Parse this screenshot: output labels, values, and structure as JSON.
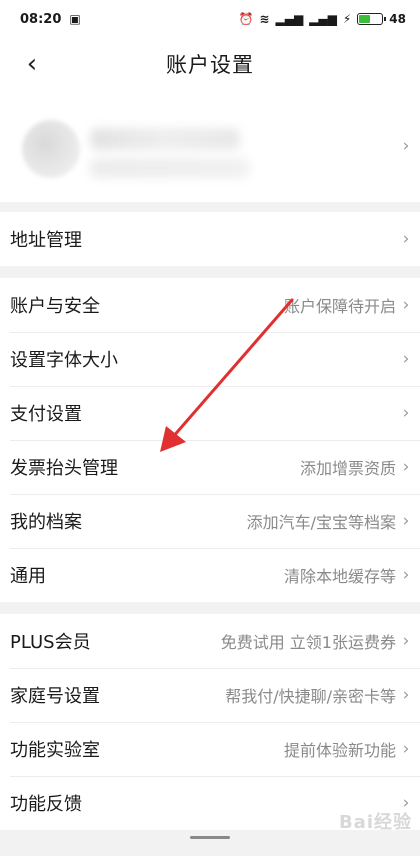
{
  "status_bar": {
    "time": "08:20",
    "signal_text": "Ꭵᥰᥰ",
    "battery_level": 48,
    "battery_label": "48"
  },
  "nav": {
    "title": "账户设置"
  },
  "sections": [
    {
      "items": [
        {
          "label": "地址管理",
          "value": ""
        }
      ]
    },
    {
      "items": [
        {
          "label": "账户与安全",
          "value": "账户保障待开启"
        },
        {
          "label": "设置字体大小",
          "value": ""
        },
        {
          "label": "支付设置",
          "value": ""
        },
        {
          "label": "发票抬头管理",
          "value": "添加增票资质"
        },
        {
          "label": "我的档案",
          "value": "添加汽车/宝宝等档案"
        },
        {
          "label": "通用",
          "value": "清除本地缓存等"
        }
      ]
    },
    {
      "items": [
        {
          "label": "PLUS会员",
          "value": "免费试用 立领1张运费券"
        },
        {
          "label": "家庭号设置",
          "value": "帮我付/快捷聊/亲密卡等"
        },
        {
          "label": "功能实验室",
          "value": "提前体验新功能"
        },
        {
          "label": "功能反馈",
          "value": ""
        }
      ]
    }
  ],
  "watermark": "Bai经验",
  "colors": {
    "background": "#f2f2f2",
    "annotation_arrow": "#e03030",
    "battery": "#3bbf3b"
  }
}
